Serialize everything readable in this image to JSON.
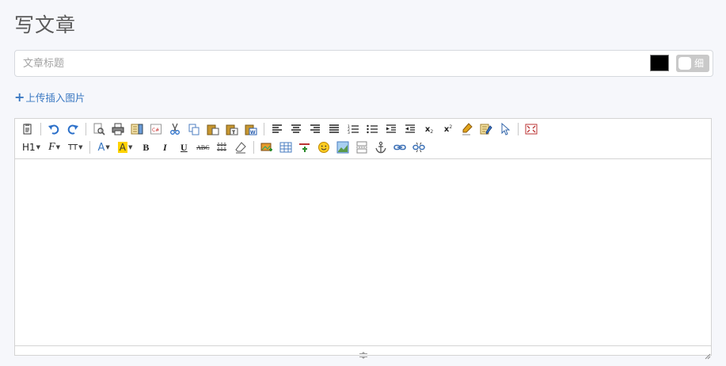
{
  "page": {
    "title": "写文章"
  },
  "title_field": {
    "placeholder": "文章标题",
    "value": ""
  },
  "title_color": {
    "color": "#000000"
  },
  "weight_toggle": {
    "label": "细"
  },
  "upload": {
    "label": "上传插入图片"
  },
  "editor": {
    "toolbar_row1": [
      "paste-as-text-icon",
      "undo-icon",
      "redo-icon",
      "preview-icon",
      "print-icon",
      "template-icon",
      "code-icon",
      "cut-icon",
      "copy-icon",
      "paste-icon",
      "paste-text-icon",
      "paste-word-icon",
      "align-left-icon",
      "align-center-icon",
      "align-right-icon",
      "align-justify-icon",
      "ordered-list-icon",
      "unordered-list-icon",
      "indent-icon",
      "outdent-icon",
      "subscript-icon",
      "superscript-icon",
      "clear-format-icon",
      "quick-format-icon",
      "select-all-icon",
      "fullscreen-icon"
    ],
    "toolbar_row2": [
      "heading-combo",
      "font-family-combo",
      "font-size-combo",
      "text-color-icon",
      "highlight-color-icon",
      "bold-icon",
      "italic-icon",
      "underline-icon",
      "strikethrough-icon",
      "line-height-icon",
      "remove-format-icon",
      "insert-image-icon",
      "insert-table-icon",
      "insert-media-icon",
      "emoticon-icon",
      "image-gallery-icon",
      "page-break-icon",
      "anchor-icon",
      "link-icon",
      "unlink-icon"
    ],
    "heading_label": "H1",
    "font_label": "F",
    "size_label": "TT",
    "color_label": "A",
    "highlight_label": "A",
    "bold_label": "B",
    "italic_label": "I",
    "underline_label": "U",
    "strike_label": "ABC",
    "sub_label": "x",
    "sup_label": "x",
    "sub_suffix": "2",
    "sup_suffix": "2",
    "colors": {
      "text": "#3a78c2",
      "highlight": "#ffd200",
      "accent": "#3a78c2"
    }
  }
}
